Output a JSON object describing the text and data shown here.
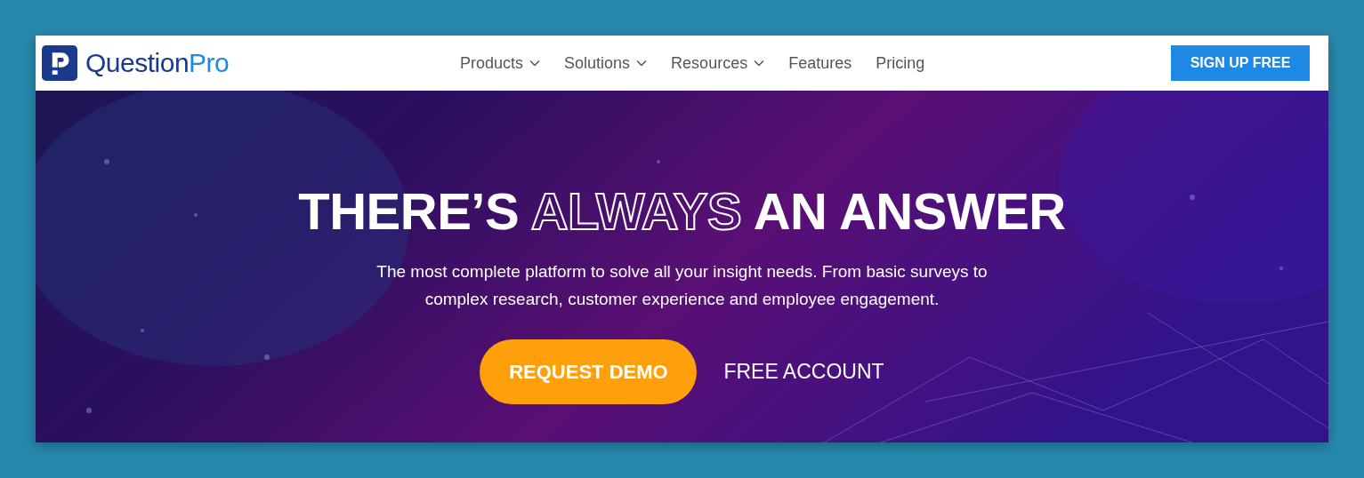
{
  "logo": {
    "words": [
      {
        "text": "Question",
        "accent": false
      },
      {
        "text": "Pro",
        "accent": true
      }
    ]
  },
  "nav": [
    {
      "label": "Products",
      "dropdown": true
    },
    {
      "label": "Solutions",
      "dropdown": true
    },
    {
      "label": "Resources",
      "dropdown": true
    },
    {
      "label": "Features",
      "dropdown": false
    },
    {
      "label": "Pricing",
      "dropdown": false
    }
  ],
  "signup": "SIGN UP FREE",
  "hero": {
    "kind": "picture",
    "headline": [
      {
        "text": "THERE’S ",
        "kind": "solid"
      },
      {
        "text": "ALWAYS",
        "kind": "outline"
      },
      {
        "text": " AN ANSWER",
        "kind": "solid"
      }
    ],
    "subtitle": "The most complete platform to solve all your insight needs. From basic surveys to complex research, customer experience and employee engagement.",
    "primary": "REQUEST DEMO",
    "secondary": "FREE ACCOUNT"
  }
}
